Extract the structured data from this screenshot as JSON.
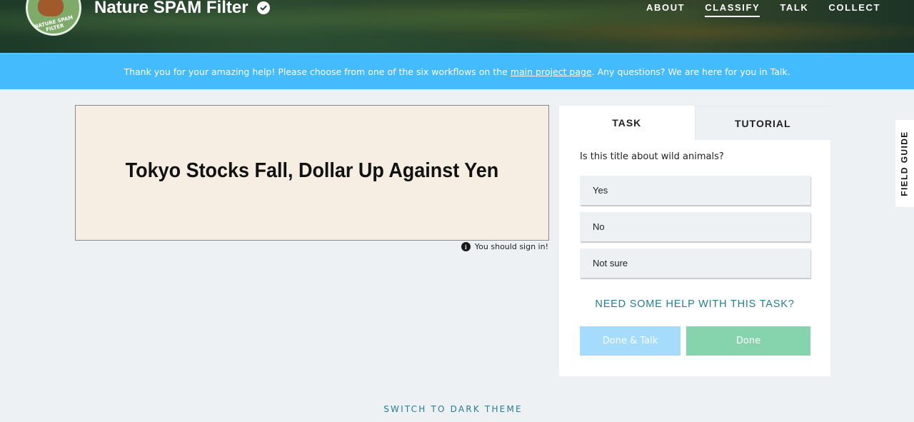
{
  "header": {
    "project_title": "Nature SPAM Filter",
    "avatar_text": "NATURE SPAM FILTER",
    "nav": [
      {
        "label": "ABOUT"
      },
      {
        "label": "CLASSIFY",
        "active": true
      },
      {
        "label": "TALK"
      },
      {
        "label": "COLLECT"
      }
    ]
  },
  "announcement": {
    "before": "Thank you for your amazing help! Please choose from one of the six workflows on the ",
    "link": "main project page",
    "after": ". Any questions? We are here for you in Talk."
  },
  "subject": {
    "title": "Tokyo Stocks Fall, Dollar Up Against Yen",
    "signin_note": "You should sign in!"
  },
  "task_panel": {
    "tabs": [
      {
        "label": "TASK"
      },
      {
        "label": "TUTORIAL"
      }
    ],
    "question": "Is this title about wild animals?",
    "answers": [
      {
        "label": "Yes"
      },
      {
        "label": "No"
      },
      {
        "label": "Not sure"
      }
    ],
    "help_link": "NEED SOME HELP WITH THIS TASK?",
    "done_talk_label": "Done & Talk",
    "done_label": "Done"
  },
  "field_guide_label": "FIELD GUIDE",
  "theme_switch_label": "SWITCH TO DARK THEME",
  "colors": {
    "announcement": "#43bbfd",
    "done_button": "#86d4ae",
    "done_talk_button": "#a6dcfb",
    "link_teal": "#2a7a90",
    "subject_bg": "#f6ede3"
  }
}
